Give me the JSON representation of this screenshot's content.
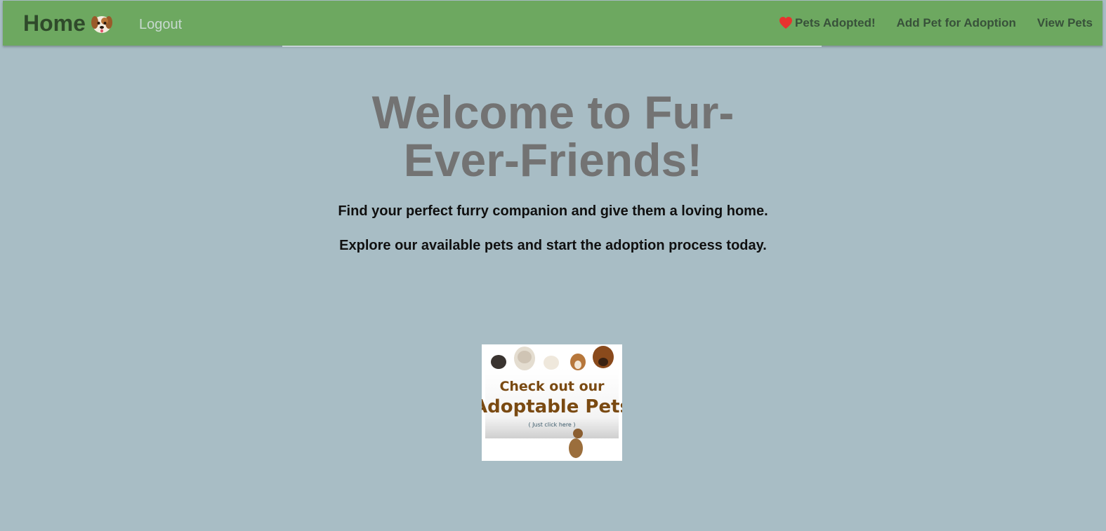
{
  "nav": {
    "brand_label": "Home",
    "logout_label": "Logout",
    "links": [
      {
        "label": "Pets Adopted!",
        "icon": "heart-icon"
      },
      {
        "label": "Add Pet for Adoption"
      },
      {
        "label": "View Pets"
      }
    ]
  },
  "hero": {
    "title": "Welcome to Fur-Ever-Friends!",
    "subtitle": "Find your perfect furry companion and give them a loving home.",
    "subtitle2": "Explore our available pets and start the adoption process today."
  },
  "promo": {
    "line1": "Check out our",
    "line2": "Adoptable Pets",
    "line3": "( Just click here )"
  },
  "colors": {
    "navbar": "#6da860",
    "background": "#a8bdc5",
    "title": "#737373",
    "promo_text": "#7a4a12"
  }
}
